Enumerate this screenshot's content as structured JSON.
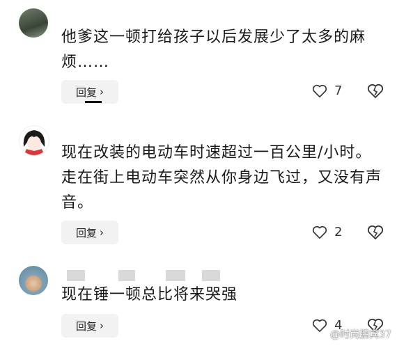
{
  "comments": [
    {
      "text": "他爹这一顿打给孩子以后发展少了太多的麻烦……",
      "reply_label": "回复",
      "likes": "7"
    },
    {
      "text": "现在改装的电动车时速超过一百公里/小时。走在街上电动车突然从你身边飞过，又没有声音。",
      "reply_label": "回复",
      "likes": "2"
    },
    {
      "text": "现在锤一顿总比将来哭强",
      "reply_label": "回复",
      "likes": "4"
    }
  ],
  "icons": {
    "reply_arrow": "chevron-right-icon",
    "like": "heart-outline-icon",
    "dislike": "broken-heart-icon"
  },
  "watermark": "@时尚鹏宾37"
}
